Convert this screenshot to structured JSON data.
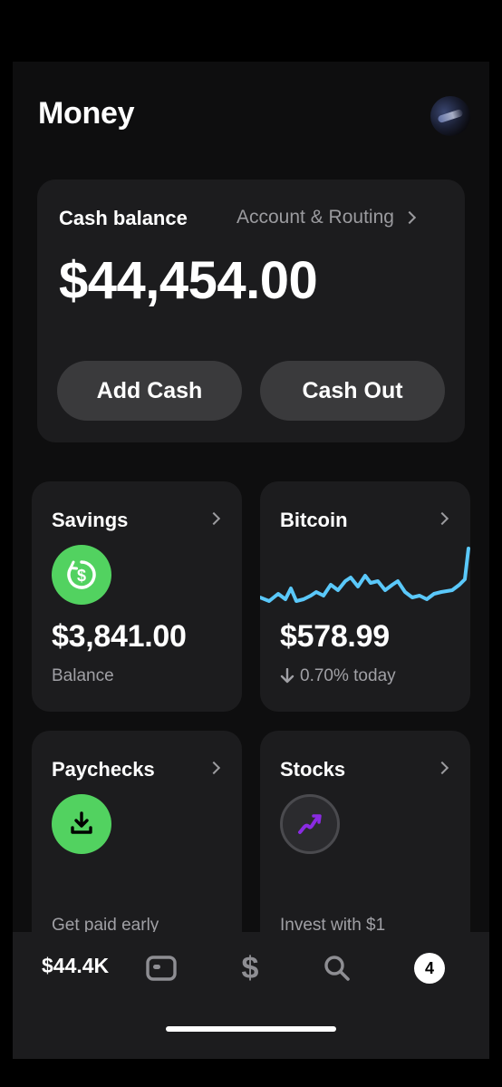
{
  "header": {
    "title": "Money"
  },
  "balance": {
    "label": "Cash balance",
    "link": "Account & Routing",
    "amount": "$44,454.00",
    "add_cash": "Add Cash",
    "cash_out": "Cash Out"
  },
  "tiles": {
    "savings": {
      "title": "Savings",
      "value": "$3,841.00",
      "sub": "Balance"
    },
    "bitcoin": {
      "title": "Bitcoin",
      "value": "$578.99",
      "change": "0.70% today",
      "trend": "down",
      "line_color": "#5ac8fa"
    },
    "paychecks": {
      "title": "Paychecks",
      "footer": "Get paid early"
    },
    "stocks": {
      "title": "Stocks",
      "footer": "Invest with $1"
    }
  },
  "nav": {
    "balance": "$44.4K",
    "dollar_glyph": "$",
    "badge_count": "4"
  },
  "colors": {
    "accent_green": "#52d260",
    "background": "#0e0e0f",
    "card": "#1c1c1e",
    "stocks_accent": "#8a2be2"
  }
}
